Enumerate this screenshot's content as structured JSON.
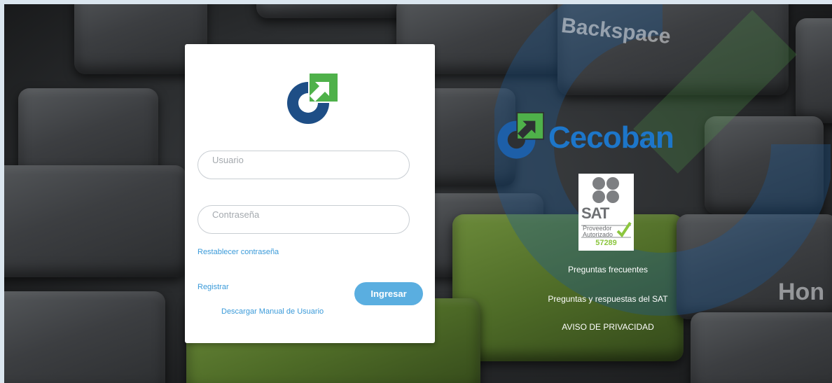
{
  "login": {
    "username_placeholder": "Usuario",
    "password_placeholder": "Contraseña",
    "reset_password": "Restablecer contraseña",
    "register": "Registrar",
    "submit": "Ingresar",
    "download_manual": "Descargar Manual de Usuario"
  },
  "brand": {
    "name": "Cecoban"
  },
  "sat_badge": {
    "title": "SAT",
    "line1": "Proveedor",
    "line2": "Autorizado",
    "number": "57289"
  },
  "right_links": [
    "Preguntas frecuentes",
    "Preguntas y respuestas del SAT",
    "AVISO DE PRIVACIDAD"
  ],
  "background": {
    "key_labels": [
      "Backspace",
      "Hon"
    ]
  },
  "colors": {
    "brand_blue": "#1d76c9",
    "logo_navy": "#1e4e86",
    "logo_green": "#4fb14a",
    "link_blue": "#3a9ad9",
    "button_blue": "#5aaee0"
  }
}
